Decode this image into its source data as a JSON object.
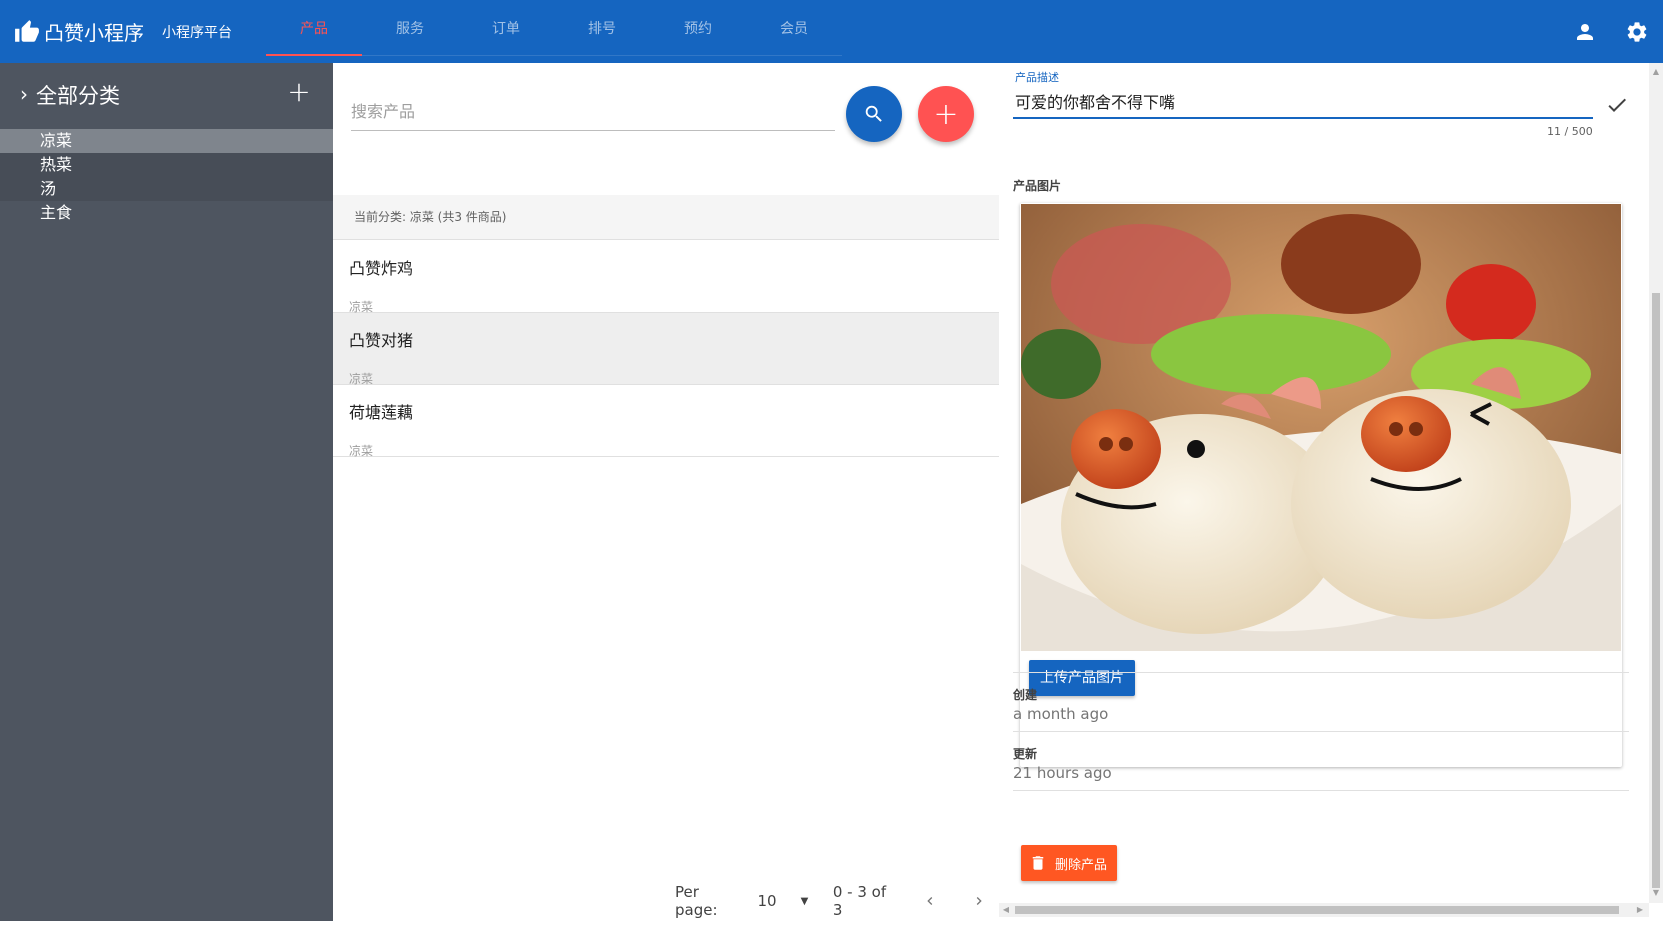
{
  "app": {
    "title": "凸赞小程序",
    "subtitle": "小程序平台",
    "brand_icon": "thumb-up-icon",
    "primary_color": "#1565c0",
    "accent_color": "#ff5252"
  },
  "nav": {
    "tabs": [
      {
        "label": "产品",
        "active": true
      },
      {
        "label": "服务",
        "active": false
      },
      {
        "label": "订单",
        "active": false
      },
      {
        "label": "排号",
        "active": false
      },
      {
        "label": "预约",
        "active": false
      },
      {
        "label": "会员",
        "active": false
      }
    ],
    "icons": [
      "account-icon",
      "settings-icon"
    ]
  },
  "sidebar": {
    "title": "全部分类",
    "add_icon": "plus-icon",
    "items": [
      {
        "label": "凉菜",
        "active": true
      },
      {
        "label": "热菜",
        "active": false
      },
      {
        "label": "汤",
        "active": false
      },
      {
        "label": "主食",
        "active": false
      }
    ]
  },
  "products": {
    "search_placeholder": "搜索产品",
    "search_value": "",
    "category_header": "当前分类: 凉菜 (共3 件商品)",
    "items": [
      {
        "name": "凸赞炸鸡",
        "category": "凉菜",
        "selected": false
      },
      {
        "name": "凸赞对猪",
        "category": "凉菜",
        "selected": true
      },
      {
        "name": "荷塘莲藕",
        "category": "凉菜",
        "selected": false
      }
    ],
    "pagination": {
      "per_page_label": "Per page:",
      "per_page_value": "10",
      "range": "0 - 3 of 3"
    }
  },
  "detail": {
    "description_label": "产品描述",
    "description_value": "可爱的你都舍不得下嘴",
    "counter": "11 / 500",
    "image_label": "产品图片",
    "upload_button": "上传产品图片",
    "created_label": "创建",
    "created_value": "a month ago",
    "updated_label": "更新",
    "updated_value": "21 hours ago",
    "delete_button": "删除产品",
    "delete_color": "#ff5722"
  }
}
